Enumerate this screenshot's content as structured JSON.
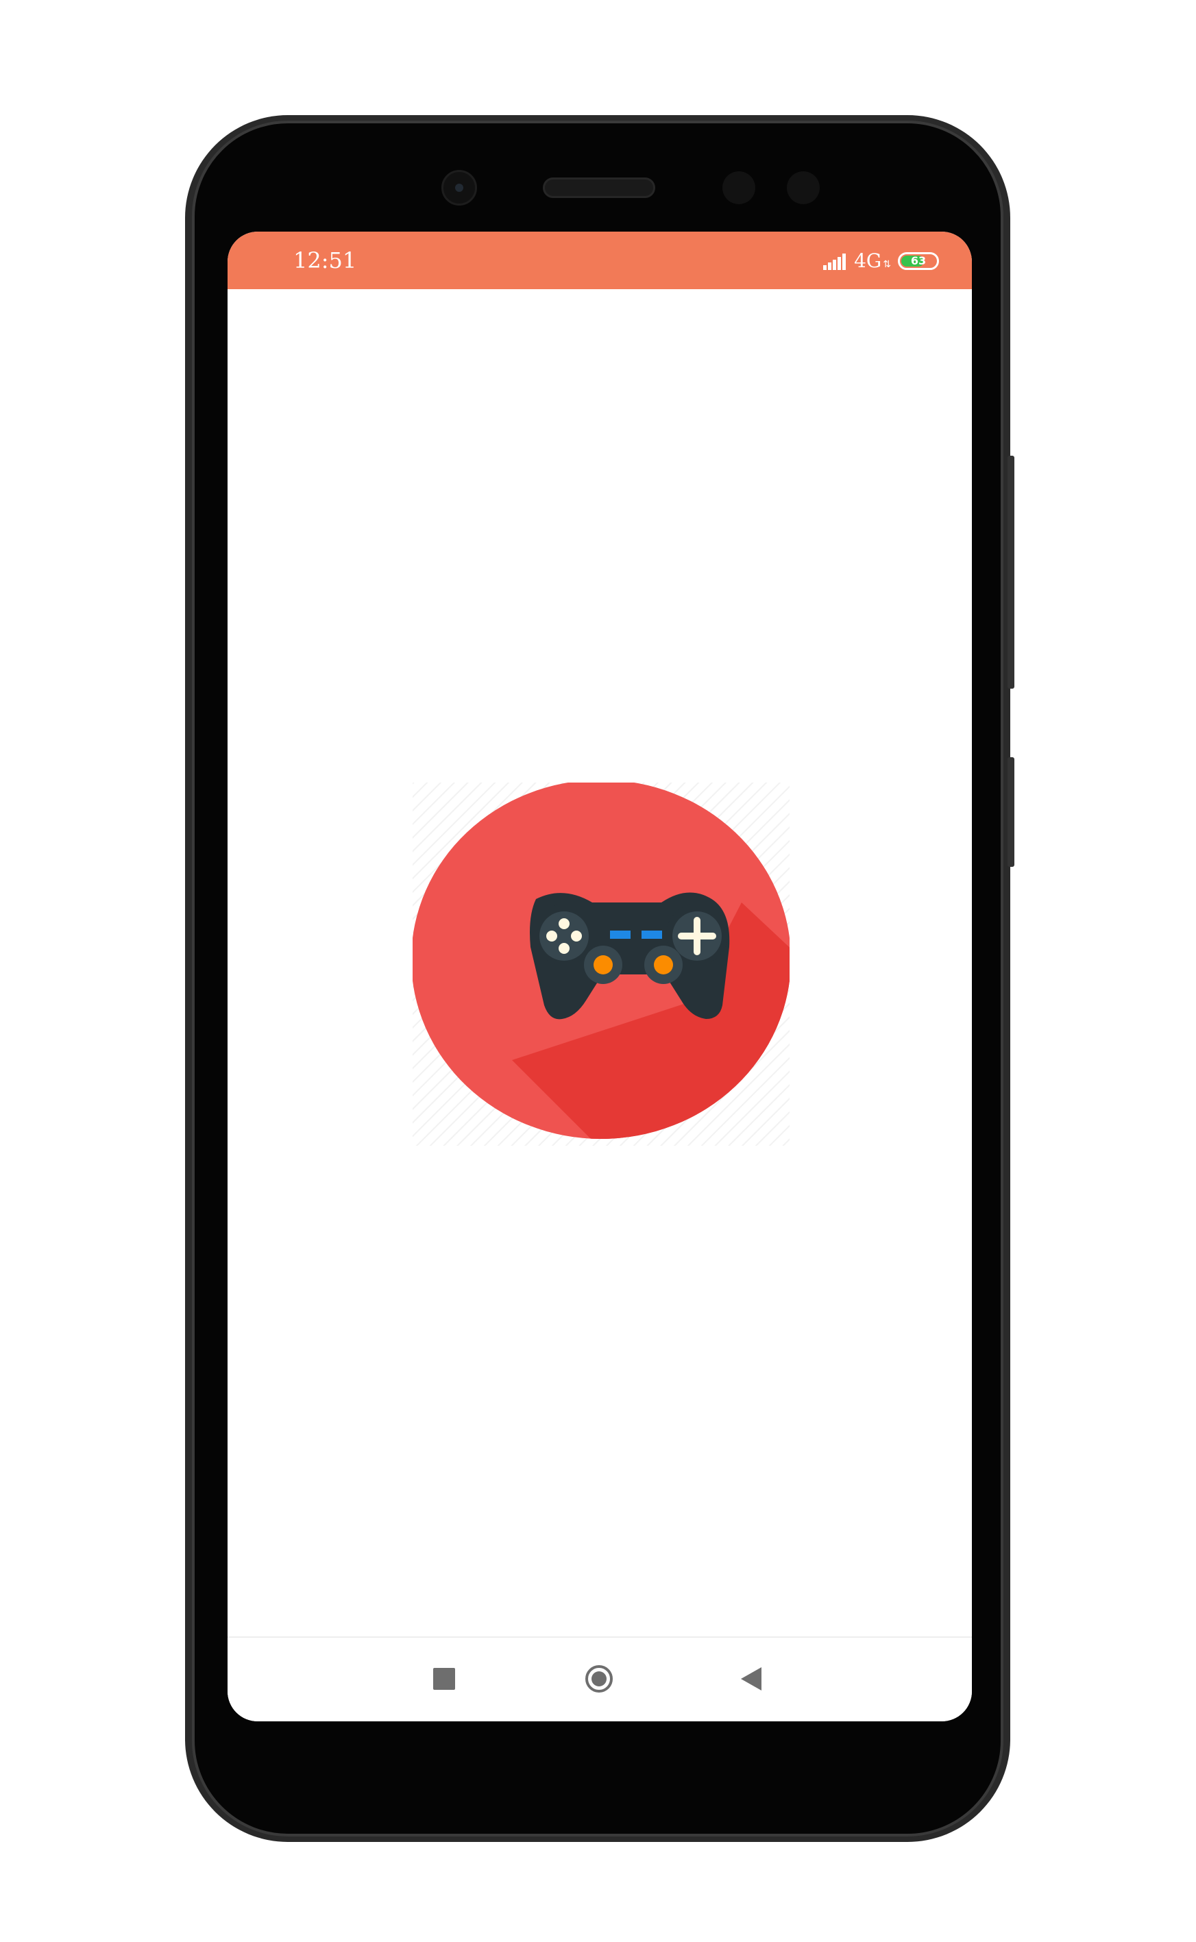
{
  "status_bar": {
    "time": "12:51",
    "network": "4G",
    "network_arrows": "⇅",
    "battery_level": "63",
    "background_color": "#f27a57",
    "battery_color": "#37c24d"
  },
  "app_logo": {
    "icon": "gamepad-icon",
    "circle_color": "#ef5350",
    "shadow_color": "#e53935",
    "controller_color": "#263238",
    "button_accent_color": "#fb8c00",
    "select_start_color": "#1e88e5"
  },
  "nav_bar": {
    "recents_icon": "square-icon",
    "home_icon": "circle-icon",
    "back_icon": "triangle-back-icon"
  }
}
